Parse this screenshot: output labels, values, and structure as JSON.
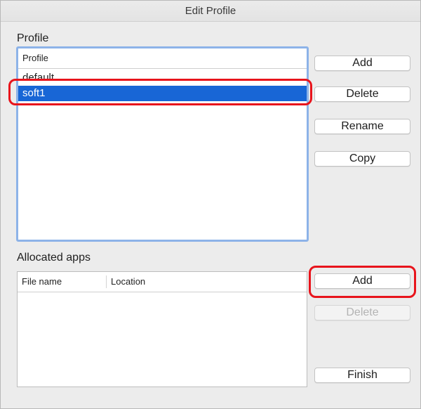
{
  "window": {
    "title": "Edit Profile"
  },
  "profile_section": {
    "label": "Profile",
    "column_header": "Profile",
    "rows": [
      {
        "label": "default",
        "selected": false
      },
      {
        "label": "soft1",
        "selected": true
      }
    ],
    "buttons": {
      "add": "Add",
      "delete": "Delete",
      "rename": "Rename",
      "copy": "Copy"
    }
  },
  "apps_section": {
    "label": "Allocated apps",
    "columns": [
      "File name",
      "Location"
    ],
    "rows": [],
    "buttons": {
      "add": "Add",
      "delete": "Delete",
      "finish": "Finish"
    }
  },
  "colors": {
    "selection": "#1866d6",
    "callout": "#e8141c",
    "focus_ring": "#8db3e8"
  }
}
